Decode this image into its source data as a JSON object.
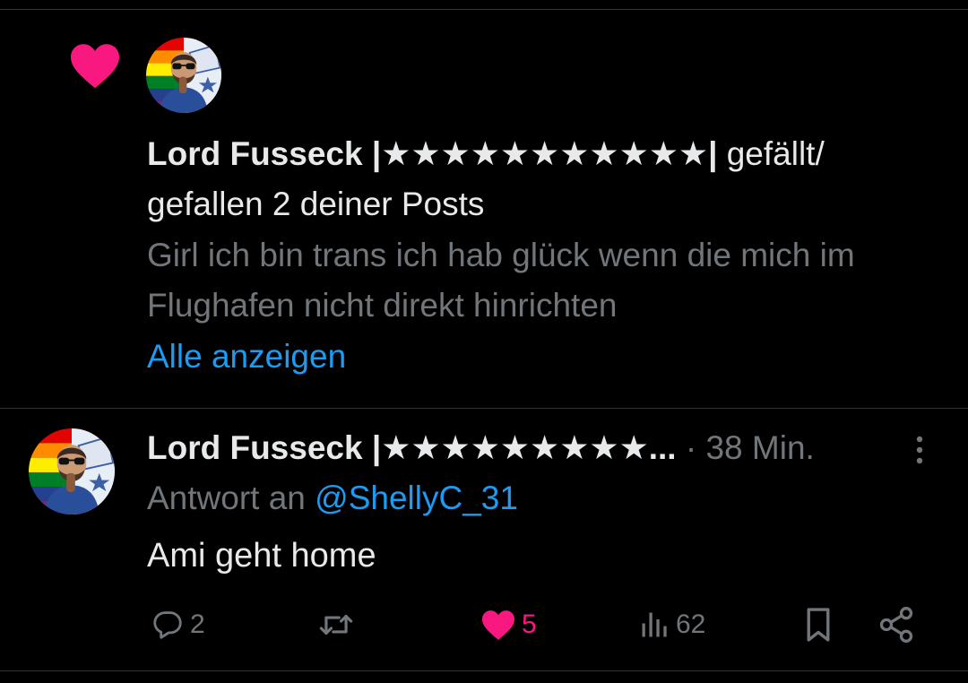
{
  "notification": {
    "name": "Lord Fusseck |★★★★★★★★★★★|",
    "action_text": " gefällt/ gefallen 2 deiner Posts",
    "preview": "Girl ich bin trans ich hab glück wenn die mich im Flughafen nicht direkt hinrichten",
    "show_all": "Alle anzeigen",
    "heart_icon": "heart-icon",
    "heart_color": "#f91880"
  },
  "tweet": {
    "name": "Lord Fusseck |★★★★★★★★★...",
    "separator": " · ",
    "time": "38 Min.",
    "reply_prefix": "Antwort an ",
    "reply_to": "@ShellyC_31",
    "text": "Ami geht home",
    "actions": {
      "replies": "2",
      "retweets": "",
      "likes": "5",
      "views": "62"
    }
  },
  "colors": {
    "background": "#000000",
    "text": "#e7e9ea",
    "secondary": "#71767b",
    "link": "#1d9bf0",
    "like": "#f91880",
    "divider": "#2f3336"
  }
}
